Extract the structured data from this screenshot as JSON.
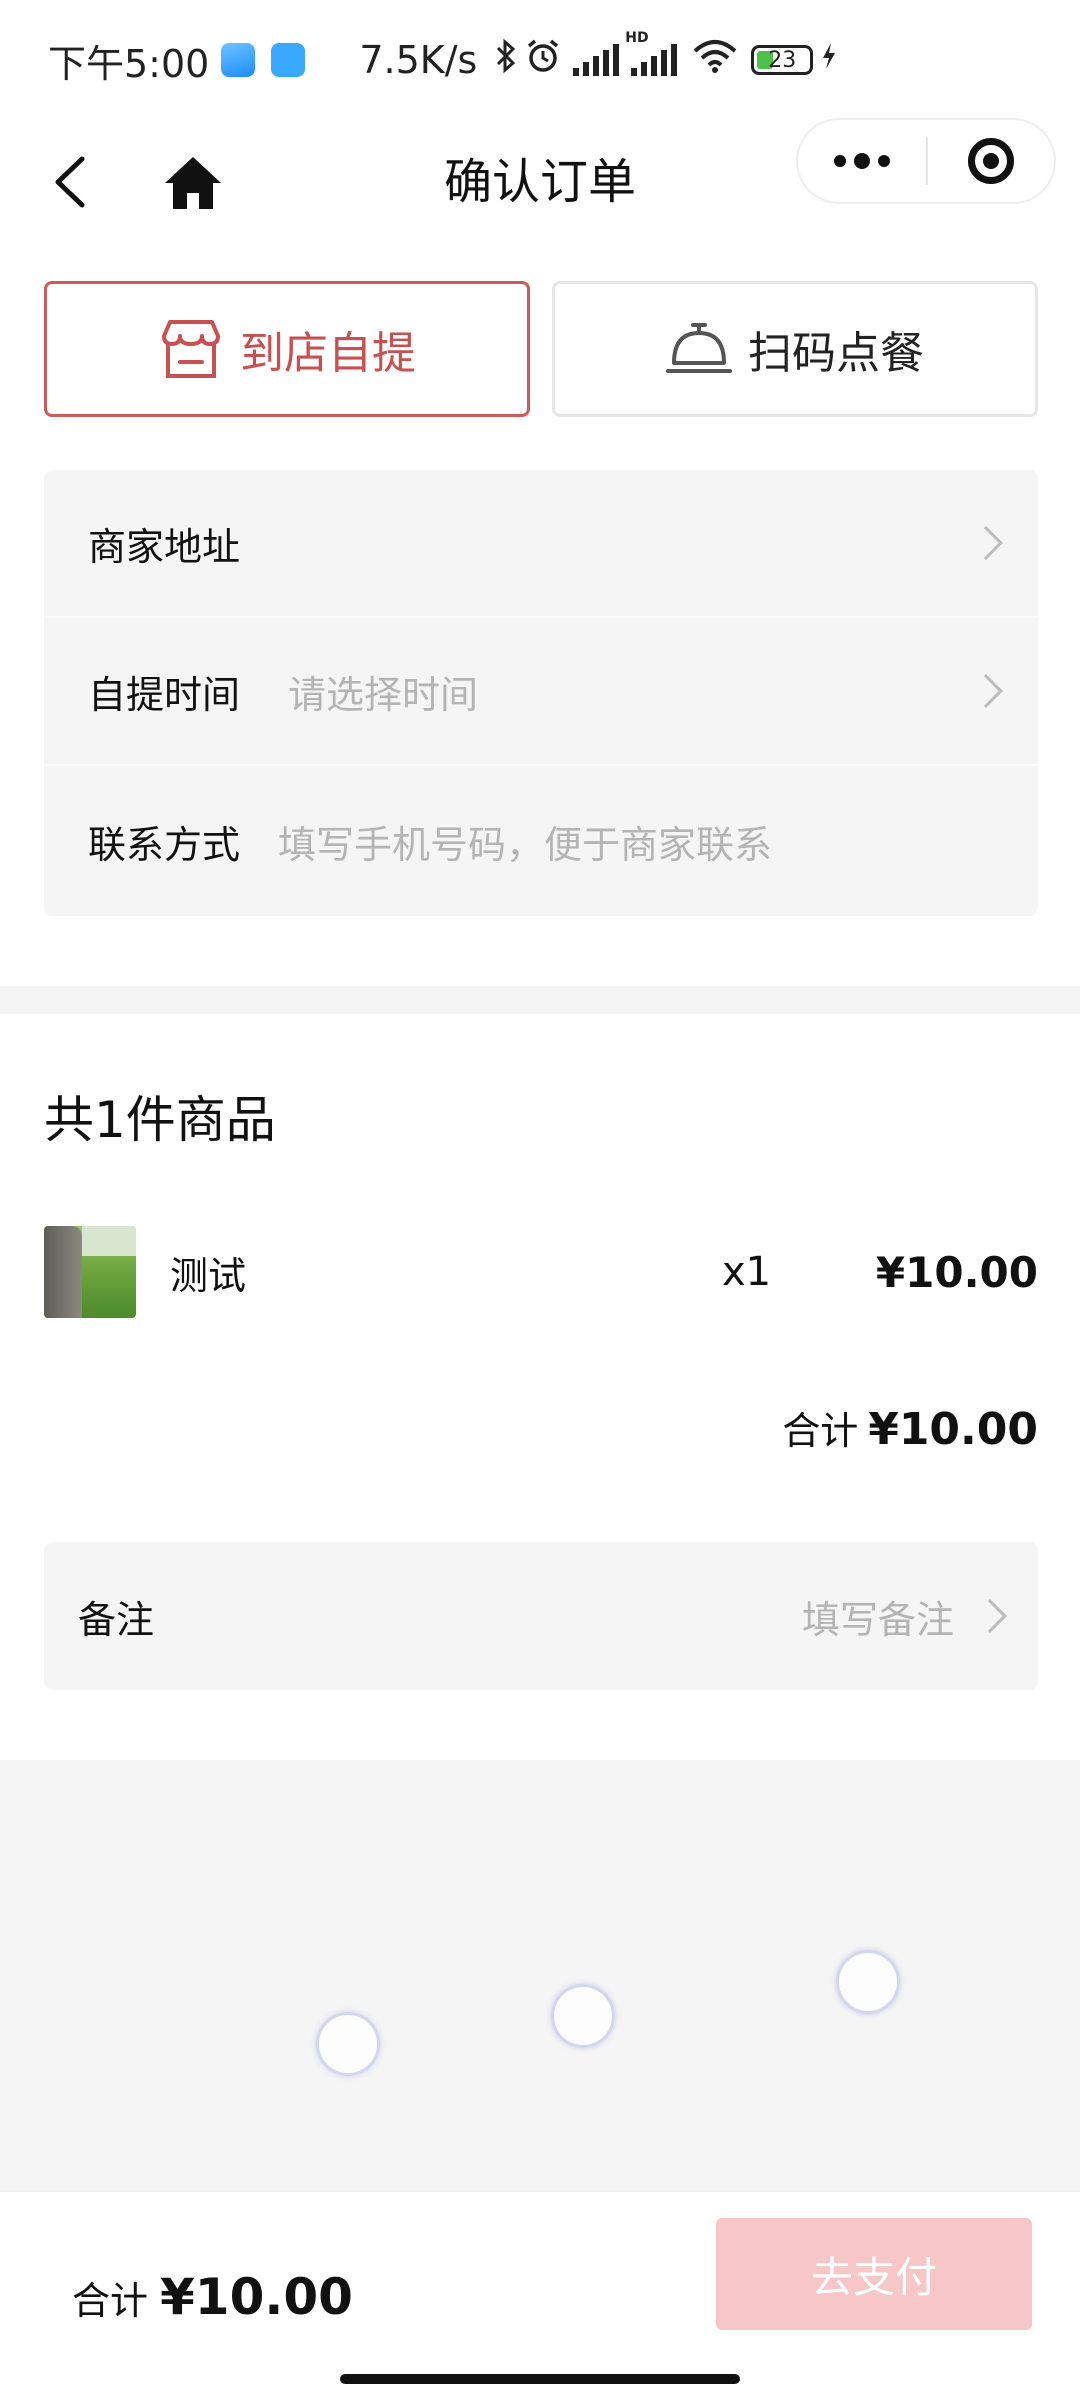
{
  "status_bar": {
    "time": "下午5:00",
    "net_speed": "7.5K/s",
    "hd_label": "HD",
    "battery": "23"
  },
  "nav": {
    "title": "确认订单"
  },
  "modes": {
    "pickup": "到店自提",
    "scan": "扫码点餐",
    "active": "pickup",
    "active_color": "#cd5b5b"
  },
  "info": {
    "address_label": "商家地址",
    "time_label": "自提时间",
    "time_placeholder": "请选择时间",
    "contact_label": "联系方式",
    "contact_placeholder": "填写手机号码，便于商家联系"
  },
  "goods": {
    "title": "共1件商品",
    "items": [
      {
        "name": "测试",
        "qty": "x1",
        "price": "¥10.00"
      }
    ],
    "subtotal_label": "合计",
    "subtotal_amount": "¥10.00"
  },
  "remark": {
    "label": "备注",
    "placeholder": "填写备注"
  },
  "footer": {
    "total_label": "合计",
    "total_amount": "¥10.00",
    "pay_label": "去支付",
    "pay_color": "#f7c6c6"
  }
}
